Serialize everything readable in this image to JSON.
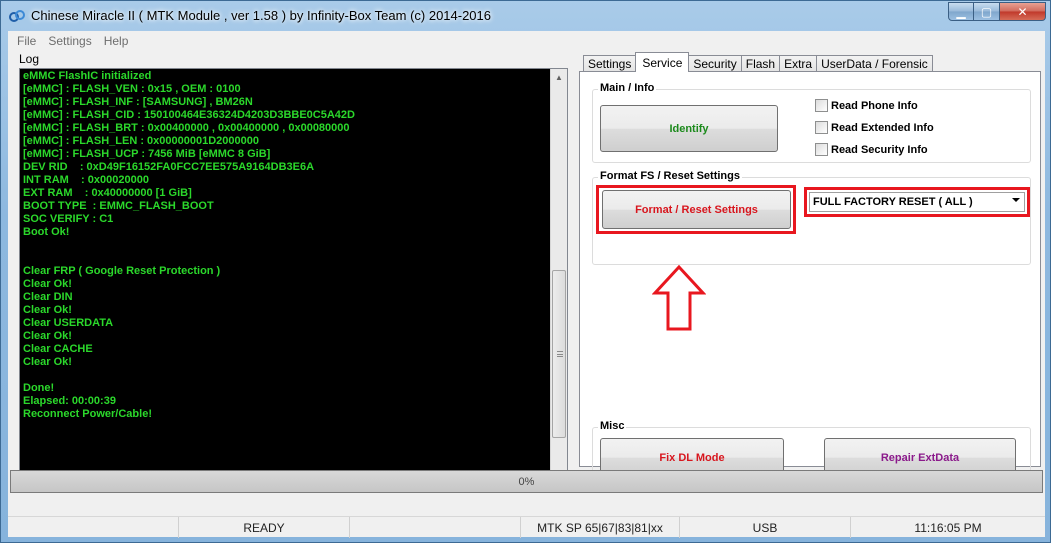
{
  "window": {
    "title": "Chinese Miracle II ( MTK Module , ver 1.58 ) by Infinity-Box Team (c) 2014-2016",
    "min_label": "▁",
    "max_label": "▢",
    "close_label": "✕"
  },
  "menu": {
    "file": "File",
    "settings": "Settings",
    "help": "Help"
  },
  "log": {
    "label": "Log",
    "lines": [
      "eMMC FlashIC initialized",
      "[eMMC] : FLASH_VEN : 0x15 , OEM : 0100",
      "[eMMC] : FLASH_INF : [SAMSUNG] , BM26N",
      "[eMMC] : FLASH_CID : 150100464E36324D4203D3BBE0C5A42D",
      "[eMMC] : FLASH_BRT : 0x00400000 , 0x00400000 , 0x00080000",
      "[eMMC] : FLASH_LEN : 0x00000001D2000000",
      "[eMMC] : FLASH_UCP : 7456 MiB [eMMC 8 GiB]",
      "DEV RID    : 0xD49F16152FA0FCC7EE575A9164DB3E6A",
      "INT RAM    : 0x00020000",
      "EXT RAM    : 0x40000000 [1 GiB]",
      "BOOT TYPE  : EMMC_FLASH_BOOT",
      "SOC VERIFY : C1",
      "Boot Ok!",
      "",
      "",
      "Clear FRP ( Google Reset Protection )",
      "Clear Ok!",
      "Clear DIN",
      "Clear Ok!",
      "Clear USERDATA",
      "Clear Ok!",
      "Clear CACHE",
      "Clear Ok!",
      "",
      "Done!",
      "Elapsed: 00:00:39",
      "Reconnect Power/Cable!"
    ]
  },
  "tabs": [
    {
      "label": "Settings",
      "active": false
    },
    {
      "label": "Service",
      "active": true
    },
    {
      "label": "Security",
      "active": false
    },
    {
      "label": "Flash",
      "active": false
    },
    {
      "label": "Extra",
      "active": false
    },
    {
      "label": "UserData / Forensic",
      "active": false
    }
  ],
  "service": {
    "main_info": {
      "title": "Main / Info",
      "identify_label": "Identify",
      "identify_color": "#1c8a1c",
      "checkboxes": [
        {
          "label": "Read Phone Info",
          "checked": false
        },
        {
          "label": "Read Extended Info",
          "checked": false
        },
        {
          "label": "Read Security Info",
          "checked": false
        }
      ]
    },
    "format": {
      "title": "Format FS / Reset Settings",
      "button_label": "Format / Reset Settings",
      "button_color": "#d8161e",
      "select_value": "FULL FACTORY RESET ( ALL )",
      "highlight_color": "#e8171f"
    },
    "misc": {
      "title": "Misc",
      "fix_dl_label": "Fix DL Mode",
      "fix_dl_color": "#d8161e",
      "repair_label": "Repair ExtData",
      "repair_color": "#8b1a8b"
    }
  },
  "progress": {
    "text": "0%",
    "fraction": 0
  },
  "status": {
    "cells": [
      "",
      "READY",
      "",
      "MTK SP 65|67|83|81|xx",
      "USB",
      "11:16:05 PM"
    ]
  }
}
